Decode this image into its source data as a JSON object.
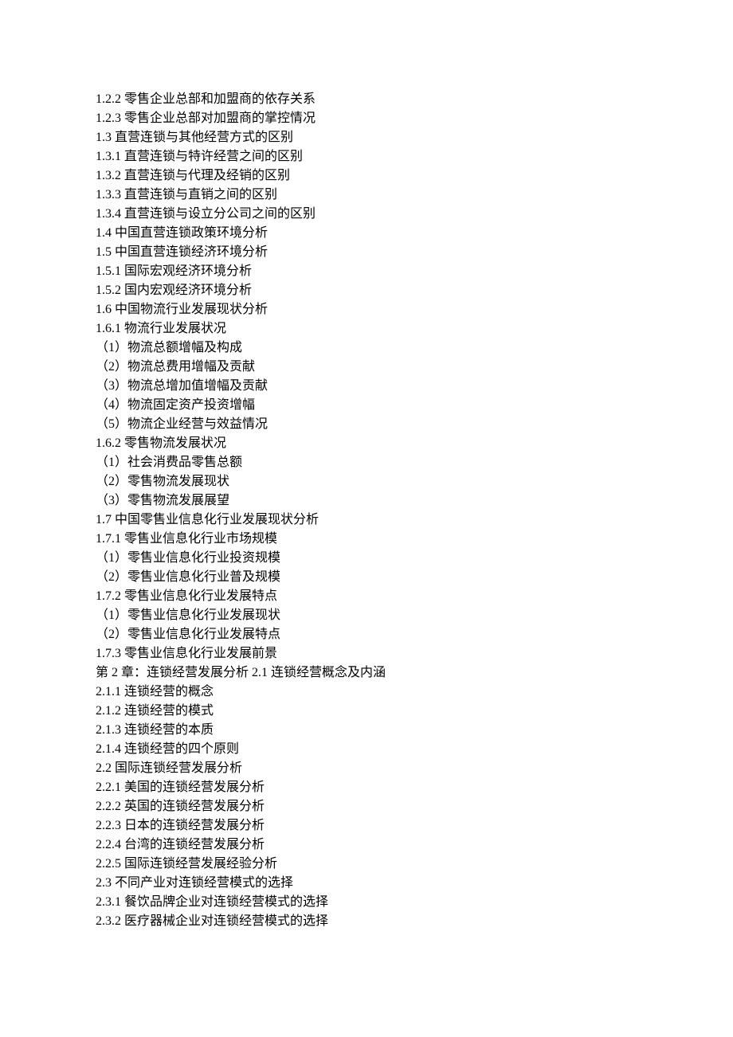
{
  "lines": [
    "1.2.2 零售企业总部和加盟商的依存关系",
    "1.2.3 零售企业总部对加盟商的掌控情况",
    "1.3 直营连锁与其他经营方式的区别",
    "1.3.1 直营连锁与特许经营之间的区别",
    "1.3.2 直营连锁与代理及经销的区别",
    "1.3.3 直营连锁与直销之间的区别",
    "1.3.4 直营连锁与设立分公司之间的区别",
    "1.4 中国直营连锁政策环境分析",
    "1.5 中国直营连锁经济环境分析",
    "1.5.1 国际宏观经济环境分析",
    "1.5.2 国内宏观经济环境分析",
    "1.6 中国物流行业发展现状分析",
    "1.6.1 物流行业发展状况",
    "（1）物流总额增幅及构成",
    "（2）物流总费用增幅及贡献",
    "（3）物流总增加值增幅及贡献",
    "（4）物流固定资产投资增幅",
    "（5）物流企业经营与效益情况",
    "1.6.2 零售物流发展状况",
    "（1）社会消费品零售总额",
    "（2）零售物流发展现状",
    "（3）零售物流发展展望",
    "1.7 中国零售业信息化行业发展现状分析",
    "1.7.1 零售业信息化行业市场规模",
    "（1）零售业信息化行业投资规模",
    "（2）零售业信息化行业普及规模",
    "1.7.2 零售业信息化行业发展特点",
    "（1）零售业信息化行业发展现状",
    "（2）零售业信息化行业发展特点",
    "1.7.3 零售业信息化行业发展前景",
    "第 2 章：连锁经营发展分析 2.1 连锁经营概念及内涵",
    "2.1.1 连锁经营的概念",
    "2.1.2 连锁经营的模式",
    "2.1.3 连锁经营的本质",
    "2.1.4 连锁经营的四个原则",
    "2.2 国际连锁经营发展分析",
    "2.2.1 美国的连锁经营发展分析",
    "2.2.2 英国的连锁经营发展分析",
    "2.2.3 日本的连锁经营发展分析",
    "2.2.4 台湾的连锁经营发展分析",
    "2.2.5 国际连锁经营发展经验分析",
    "2.3 不同产业对连锁经营模式的选择",
    "2.3.1 餐饮品牌企业对连锁经营模式的选择",
    "2.3.2 医疗器械企业对连锁经营模式的选择"
  ]
}
